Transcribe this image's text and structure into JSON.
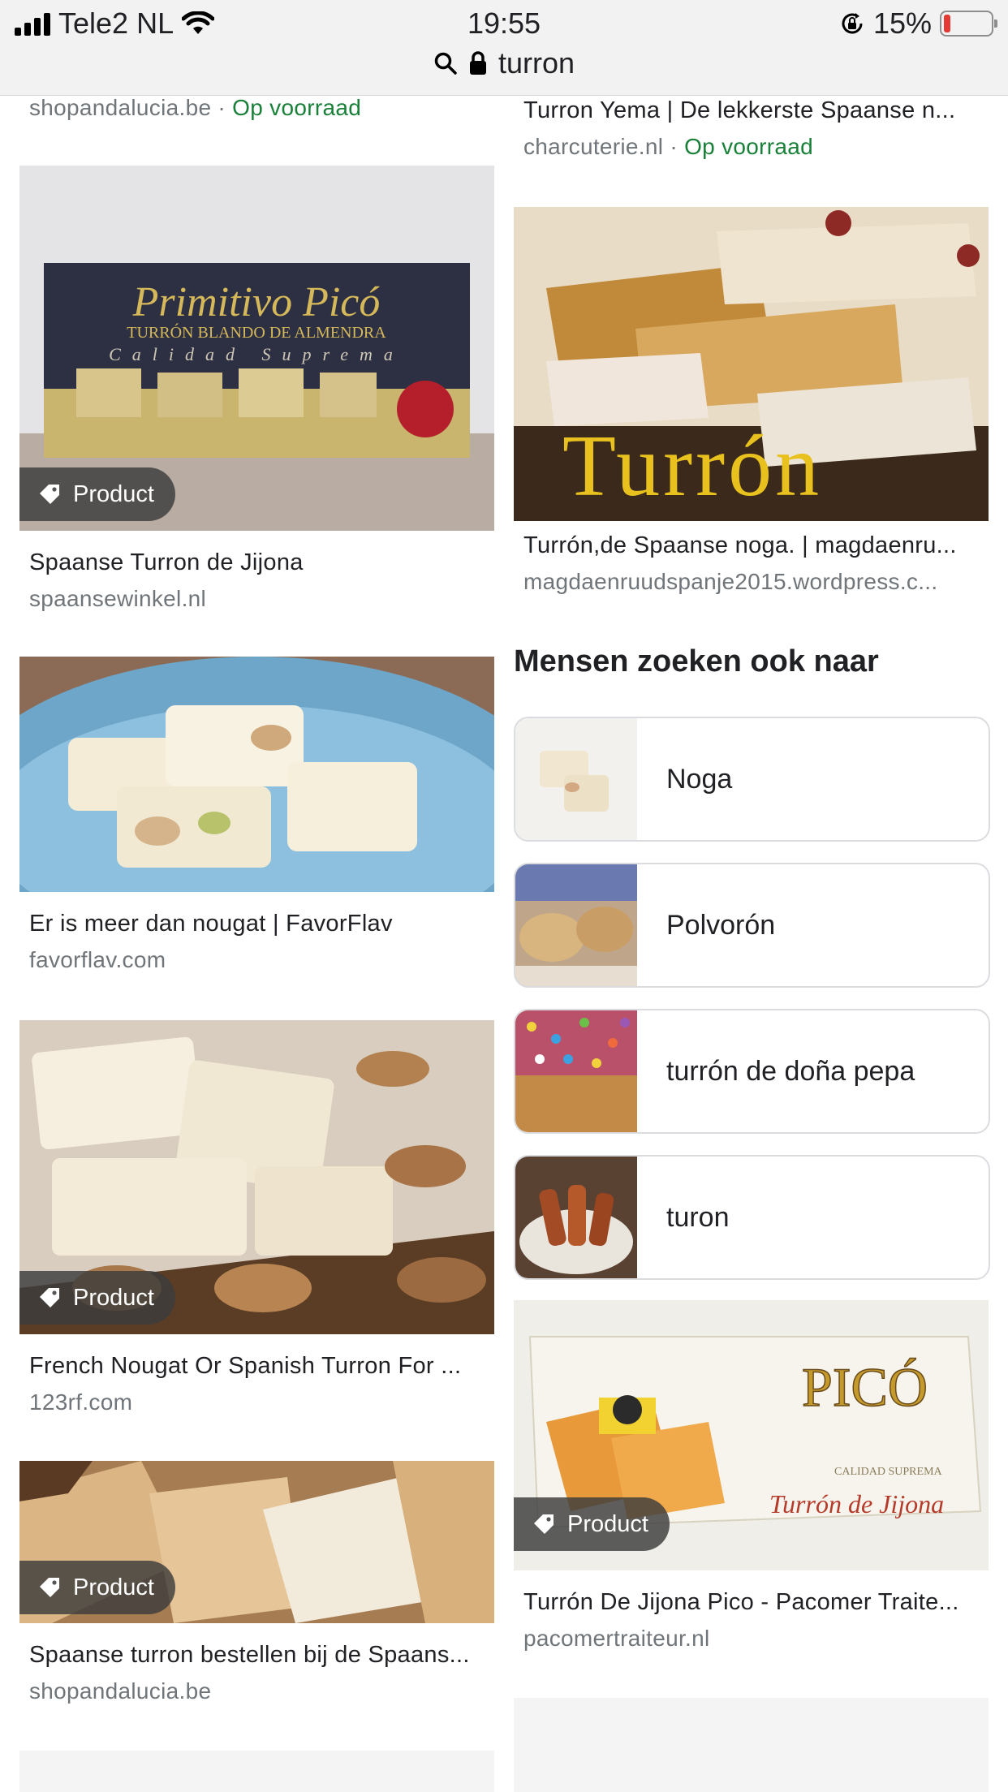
{
  "status_bar": {
    "carrier": "Tele2 NL",
    "time": "19:55",
    "battery": "15%",
    "battery_level": 0.15
  },
  "url_bar": {
    "text": "turron"
  },
  "left_column": {
    "top_partial": {
      "source": "shopandalucia.be",
      "stock": "Op voorraad"
    },
    "results": [
      {
        "title": "Spaanse Turron de Jijona",
        "source": "spaansewinkel.nl",
        "badge": "Product",
        "image_text": {
          "brand": "Primitivo Picó",
          "line1": "TURRÓN BLANDO DE ALMENDRA",
          "line2": "Calidad Suprema"
        }
      },
      {
        "title": "Er is meer dan nougat | FavorFlav",
        "source": "favorflav.com"
      },
      {
        "title": "French Nougat Or Spanish Turron For ...",
        "source": "123rf.com",
        "badge": "Product"
      },
      {
        "title": "Spaanse turron bestellen bij de Spaans...",
        "source": "shopandalucia.be",
        "badge": "Product"
      }
    ]
  },
  "right_column": {
    "top_partial": {
      "title": "Turron Yema | De lekkerste Spaanse n...",
      "source": "charcuterie.nl",
      "stock": "Op voorraad"
    },
    "results": [
      {
        "title": "Turrón,de Spaanse noga. | magdaenru...",
        "source": "magdaenruudspanje2015.wordpress.c...",
        "image_text": "Turrón"
      },
      {
        "title": "Turrón De Jijona Pico - Pacomer Traite...",
        "source": "pacomertraiteur.nl",
        "badge": "Product",
        "image_text": {
          "brand": "PICÓ",
          "line1": "Turrón de Jijona",
          "line2": "CALIDAD SUPREMA"
        }
      }
    ],
    "related": {
      "heading": "Mensen zoeken ook naar",
      "items": [
        "Noga",
        "Polvorón",
        "turrón de doña pepa",
        "turon"
      ]
    }
  }
}
